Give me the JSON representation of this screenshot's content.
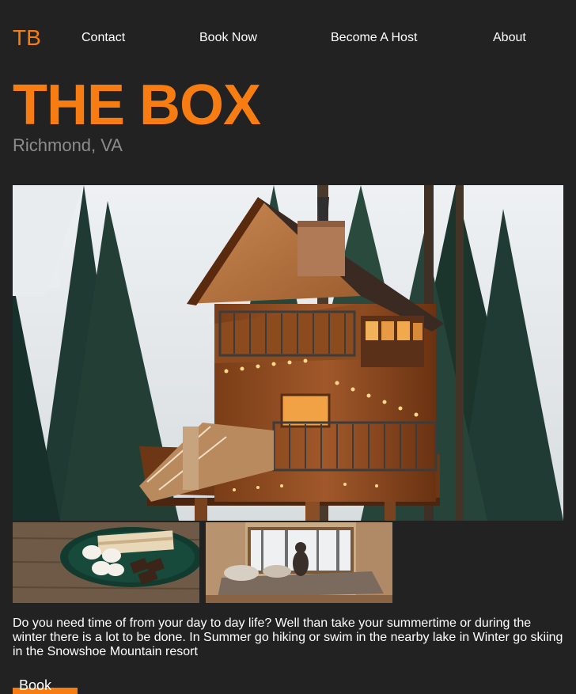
{
  "nav": {
    "logo": "TB",
    "links": [
      "Contact",
      "Book Now",
      "Become A Host",
      "About"
    ]
  },
  "hero": {
    "title": "THE BOX",
    "location": "Richmond, VA"
  },
  "gallery": {
    "main_photo": "treehouse cabin in snowy pine forest",
    "thumbnails": [
      "s'mores plate on wooden table",
      "person on bed by snowy window"
    ]
  },
  "description": "Do you need time of from your day to day life? Well than take your summertime or during the winter there is a lot to be done. In Summer go hiking or swim in the nearby lake in Winter go skiing in the Snowshoe Mountain resort",
  "cta": {
    "label": "Book now"
  },
  "colors": {
    "background": "#222222",
    "accent": "#f77d12",
    "muted_text": "#8d8d8d",
    "text": "#ffffff"
  }
}
